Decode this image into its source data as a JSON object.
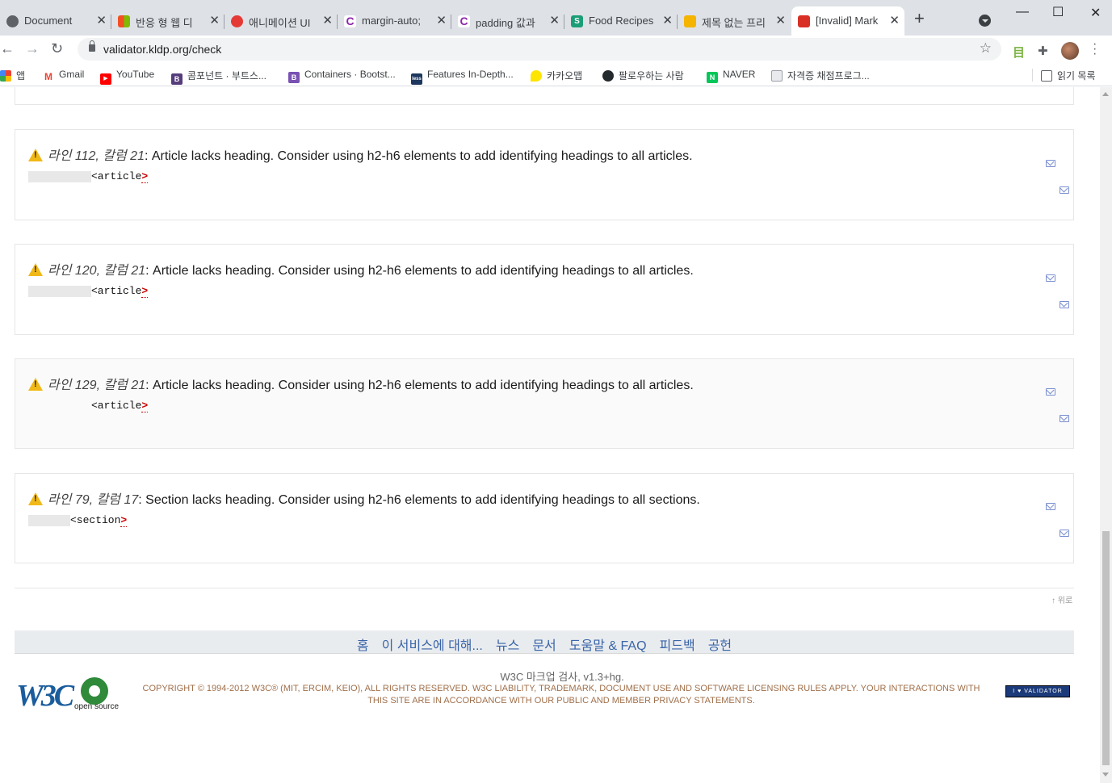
{
  "tabs": [
    {
      "title": "Document",
      "icon": "globe",
      "color": "#5f6368"
    },
    {
      "title": "반응 형 웹 디",
      "icon": "windows",
      "color": "#f25022"
    },
    {
      "title": "애니메이션 UI",
      "icon": "apple",
      "color": "#e53935"
    },
    {
      "title": "margin-auto;",
      "icon": "c-logo",
      "color": "#8e24aa"
    },
    {
      "title": "padding 값과",
      "icon": "c-logo",
      "color": "#8e24aa"
    },
    {
      "title": "Food Recipes",
      "icon": "s-logo",
      "color": "#1b9e77"
    },
    {
      "title": "제목 없는 프리",
      "icon": "slides",
      "color": "#f4b400"
    },
    {
      "title": "[Invalid] Mark",
      "icon": "w3c",
      "color": "#d93025"
    }
  ],
  "toolbar": {
    "url": "validator.kldp.org/check"
  },
  "bookmarks": [
    {
      "label": "앱",
      "color": "#4285f4",
      "icon": "apps"
    },
    {
      "label": "Gmail",
      "color": "#ea4335",
      "icon": "M"
    },
    {
      "label": "YouTube",
      "color": "#ff0000",
      "icon": "▶"
    },
    {
      "label": "콤포넌트 · 부트스...",
      "color": "#563d7c",
      "icon": "B"
    },
    {
      "label": "Containers · Bootst...",
      "color": "#7952b3",
      "icon": "B"
    },
    {
      "label": "Features In-Depth...",
      "color": "#1d365d",
      "icon": "less"
    },
    {
      "label": "카카오맵",
      "color": "#fee500",
      "icon": "map"
    },
    {
      "label": "팔로우하는 사람",
      "color": "#24292e",
      "icon": "gh"
    },
    {
      "label": "NAVER",
      "color": "#03c75a",
      "icon": "N"
    },
    {
      "label": "자격증 채점프로그...",
      "color": "#9aa0a6",
      "icon": "doc"
    }
  ],
  "reading_list": "읽기 목록",
  "messages": [
    {
      "loc": "라인 112, 칼럼 21",
      "text": ": Article lacks heading. Consider using h2-h6 elements to add identifying headings to all articles.",
      "code": "<article",
      "gt": ">"
    },
    {
      "loc": "라인 120, 칼럼 21",
      "text": ": Article lacks heading. Consider using h2-h6 elements to add identifying headings to all articles.",
      "code": "<article",
      "gt": ">"
    },
    {
      "loc": "라인 129, 칼럼 21",
      "text": ": Article lacks heading. Consider using h2-h6 elements to add identifying headings to all articles.",
      "code": "<article",
      "gt": ">"
    },
    {
      "loc": "라인 79, 칼럼 17",
      "text": ": Section lacks heading. Consider using h2-h6 elements to add identifying headings to all sections.",
      "code": "<section",
      "gt": ">"
    }
  ],
  "top_link": "↑ 위로",
  "footer_nav": [
    "홈",
    "이 서비스에 대해...",
    "뉴스",
    "문서",
    "도움말 & FAQ",
    "피드백",
    "공헌"
  ],
  "version": "W3C 마크업 검사, v1.3+hg.",
  "copyright_line1": "COPYRIGHT © 1994-2012 W3C® (MIT, ERCIM, KEIO), ALL RIGHTS RESERVED. W3C LIABILITY, TRADEMARK, DOCUMENT USE AND SOFTWARE LICENSING RULES APPLY. YOUR INTERACTIONS WITH",
  "copyright_line2": "THIS SITE ARE IN ACCORDANCE WITH OUR PUBLIC AND MEMBER PRIVACY STATEMENTS.",
  "w3c_logo": "W3C",
  "osi_text": "open source",
  "validator_badge": "I ♥ VALIDATOR"
}
